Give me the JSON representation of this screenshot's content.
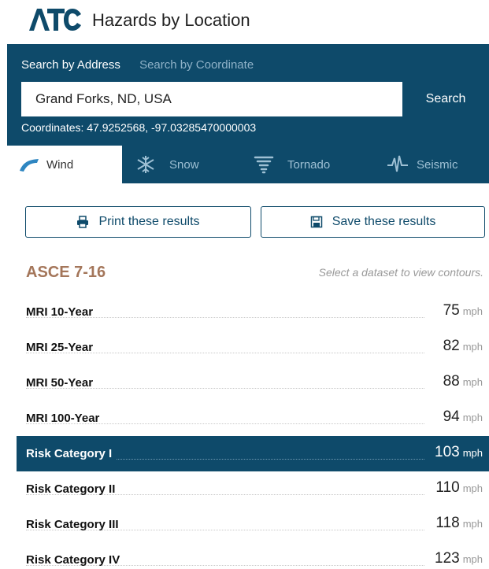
{
  "header": {
    "logo": "ATC",
    "title": "Hazards by Location"
  },
  "search": {
    "tabs": [
      "Search by Address",
      "Search by Coordinate"
    ],
    "active_tab": 0,
    "value": "Grand Forks, ND, USA",
    "button_label": "Search",
    "coordinates": "Coordinates: 47.9252568, -97.03285470000003"
  },
  "hazard_tabs": [
    {
      "label": "Wind",
      "icon": "wind-icon",
      "active": true
    },
    {
      "label": "Snow",
      "icon": "snowflake-icon",
      "active": false
    },
    {
      "label": "Tornado",
      "icon": "tornado-icon",
      "active": false
    },
    {
      "label": "Seismic",
      "icon": "seismic-icon",
      "active": false
    }
  ],
  "actions": {
    "print_label": "Print these results",
    "save_label": "Save these results"
  },
  "dataset": {
    "title": "ASCE 7-16",
    "hint": "Select a dataset to view contours.",
    "unit": "mph",
    "rows": [
      {
        "name": "MRI 10-Year",
        "value": "75"
      },
      {
        "name": "MRI 25-Year",
        "value": "82"
      },
      {
        "name": "MRI 50-Year",
        "value": "88"
      },
      {
        "name": "MRI 100-Year",
        "value": "94"
      },
      {
        "name": "Risk Category I",
        "value": "103"
      },
      {
        "name": "Risk Category II",
        "value": "110"
      },
      {
        "name": "Risk Category III",
        "value": "118"
      },
      {
        "name": "Risk Category IV",
        "value": "123"
      }
    ]
  },
  "colors": {
    "brand": "#0e4a6a",
    "title_accent": "#a4765a"
  }
}
